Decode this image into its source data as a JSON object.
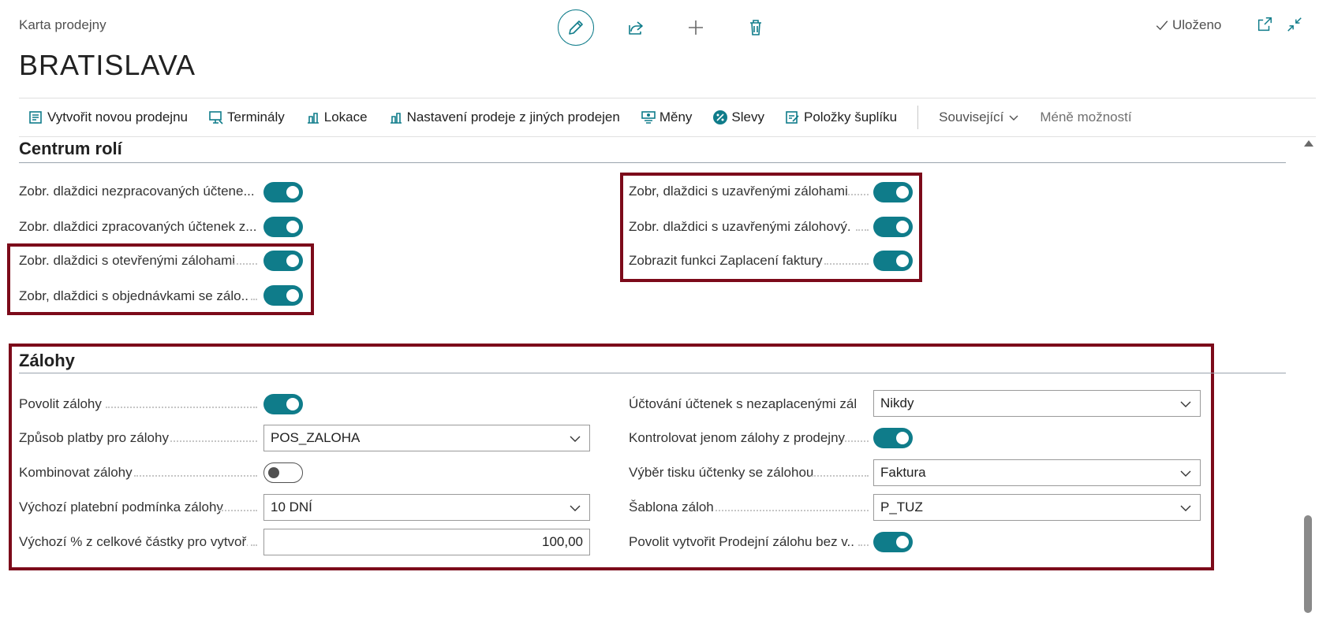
{
  "header": {
    "caption": "Karta prodejny",
    "title": "BRATISLAVA",
    "saved_label": "Uloženo"
  },
  "actions": [
    {
      "label": "Vytvořit novou prodejnu",
      "icon": "new-store-icon"
    },
    {
      "label": "Terminály",
      "icon": "terminal-icon"
    },
    {
      "label": "Lokace",
      "icon": "location-icon"
    },
    {
      "label": "Nastavení prodeje z jiných prodejen",
      "icon": "settings-stores-icon"
    },
    {
      "label": "Měny",
      "icon": "currency-icon"
    },
    {
      "label": "Slevy",
      "icon": "percent-icon"
    },
    {
      "label": "Položky šuplíku",
      "icon": "drawer-items-icon"
    },
    {
      "label": "Související",
      "icon": "chevron-down-icon"
    },
    {
      "label": "Méně možností",
      "icon": ""
    }
  ],
  "role_center": {
    "title": "Centrum rolí",
    "left": [
      {
        "label": "Zobr. dlaždici nezpracovaných účtene...",
        "value": true
      },
      {
        "label": "Zobr. dlaždici zpracovaných účtenek z...",
        "value": true
      },
      {
        "label": "Zobr. dlaždici s otevřenými zálohami",
        "value": true
      },
      {
        "label": "Zobr, dlaždici s objednávkami se zálo...",
        "value": true
      }
    ],
    "right": [
      {
        "label": "Zobr, dlaždici s uzavřenými zálohami",
        "value": true
      },
      {
        "label": "Zobr. dlaždici s uzavřenými zálohový...",
        "value": true
      },
      {
        "label": "Zobrazit funkci Zaplacení faktury",
        "value": true
      }
    ]
  },
  "deposits": {
    "title": "Zálohy",
    "left": [
      {
        "label": "Povolit zálohy",
        "type": "toggle",
        "value": true
      },
      {
        "label": "Způsob platby pro zálohy",
        "type": "select",
        "value": "POS_ZALOHA"
      },
      {
        "label": "Kombinovat zálohy",
        "type": "toggle",
        "value": false
      },
      {
        "label": "Výchozí platební podmínka zálohy",
        "type": "select",
        "value": "10 DNÍ"
      },
      {
        "label": "Výchozí % z celkové částky pro vytvoř...",
        "type": "input",
        "value": "100,00"
      }
    ],
    "right": [
      {
        "label": "Účtování účtenek s nezaplacenými zál...",
        "type": "select",
        "value": "Nikdy"
      },
      {
        "label": "Kontrolovat jenom zálohy z prodejny",
        "type": "toggle",
        "value": true
      },
      {
        "label": "Výběr tisku účtenky se zálohou",
        "type": "select",
        "value": "Faktura"
      },
      {
        "label": "Šablona záloh",
        "type": "select",
        "value": "P_TUZ"
      },
      {
        "label": "Povolit vytvořit Prodejní zálohu bez v...",
        "type": "toggle",
        "value": true
      }
    ]
  },
  "colors": {
    "accent": "#0f7c8a",
    "highlight_border": "#7c0a1a"
  }
}
